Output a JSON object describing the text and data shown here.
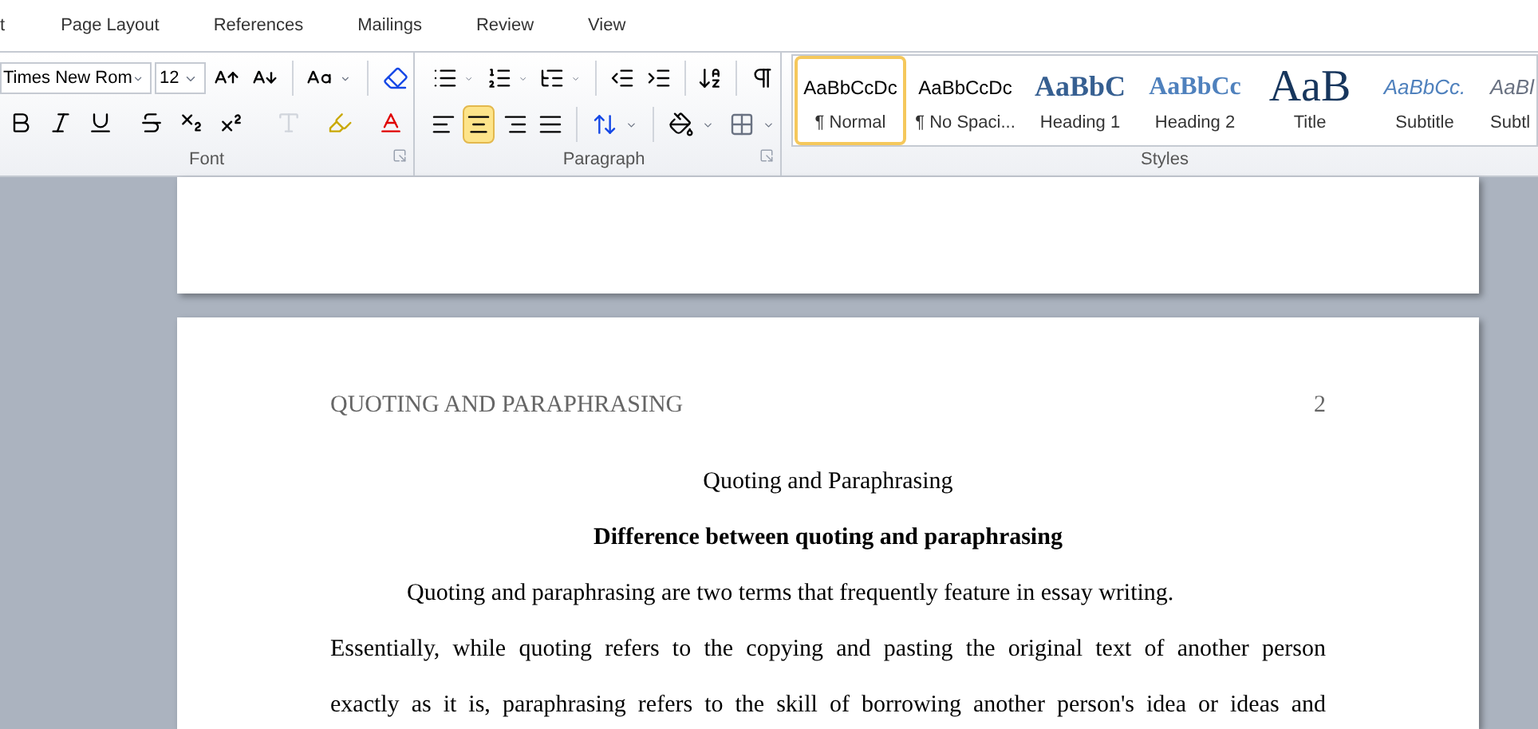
{
  "menu_tabs": [
    "t",
    "Page Layout",
    "References",
    "Mailings",
    "Review",
    "View"
  ],
  "font_group": {
    "font_name": "Times New Rom",
    "font_size": "12",
    "label": "Font"
  },
  "paragraph_group": {
    "label": "Paragraph",
    "alignments": [
      {
        "kind": "left",
        "selected": false
      },
      {
        "kind": "center",
        "selected": true
      },
      {
        "kind": "right",
        "selected": false
      },
      {
        "kind": "justify",
        "selected": false
      }
    ]
  },
  "styles_group": {
    "label": "Styles",
    "styles": [
      {
        "kind": "normal",
        "preview": "AaBbCcDc",
        "name": "¶ Normal",
        "selected": true
      },
      {
        "kind": "normal",
        "preview": "AaBbCcDc",
        "name": "¶ No Spaci...",
        "selected": false
      },
      {
        "kind": "heading1",
        "preview": "AaBbC",
        "name": "Heading 1",
        "selected": false
      },
      {
        "kind": "heading2",
        "preview": "AaBbCc",
        "name": "Heading 2",
        "selected": false
      },
      {
        "kind": "title",
        "preview": "AaB",
        "name": "Title",
        "selected": false
      },
      {
        "kind": "subtitle",
        "preview": "AaBbCc.",
        "name": "Subtitle",
        "selected": false
      },
      {
        "kind": "subtle",
        "preview": "AaBl",
        "name": "Subtl",
        "selected": false
      }
    ]
  },
  "document": {
    "running_head": "QUOTING AND PARAPHRASING",
    "page_number": "2",
    "title": "Quoting and Paraphrasing",
    "heading": "Difference between quoting and paraphrasing",
    "lines": [
      {
        "kind": "indent",
        "text": "Quoting and paraphrasing are two terms that frequently feature in essay writing."
      },
      {
        "kind": "justify",
        "text": "Essentially, while quoting refers to the copying and pasting the original text of another person"
      },
      {
        "kind": "justify",
        "text": "exactly as it is, paraphrasing refers to the skill of borrowing another person's idea or ideas and"
      }
    ]
  }
}
